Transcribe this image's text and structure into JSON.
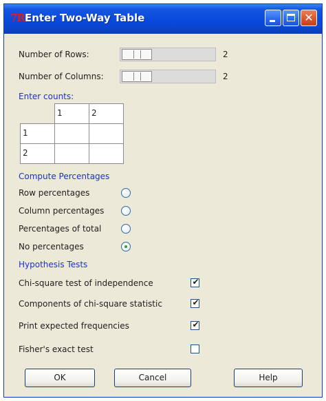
{
  "window": {
    "title": "Enter Two-Way Table",
    "app_icon": "7R"
  },
  "controls": {
    "rows": {
      "label": "Number of Rows:",
      "value": "2"
    },
    "columns": {
      "label": "Number of Columns:",
      "value": "2"
    }
  },
  "counts": {
    "heading": "Enter counts:",
    "col_headers": [
      "1",
      "2"
    ],
    "row_headers": [
      "1",
      "2"
    ],
    "cells": [
      [
        "",
        ""
      ],
      [
        "",
        ""
      ]
    ]
  },
  "percentages": {
    "heading": "Compute Percentages",
    "options": [
      {
        "label": "Row percentages",
        "selected": false
      },
      {
        "label": "Column percentages",
        "selected": false
      },
      {
        "label": "Percentages of total",
        "selected": false
      },
      {
        "label": "No percentages",
        "selected": true
      }
    ]
  },
  "tests": {
    "heading": "Hypothesis Tests",
    "options": [
      {
        "label": "Chi-square test of independence",
        "checked": true
      },
      {
        "label": "Components of chi-square statistic",
        "checked": true
      },
      {
        "label": "Print expected frequencies",
        "checked": true
      },
      {
        "label": "Fisher's exact test",
        "checked": false
      }
    ]
  },
  "buttons": {
    "ok": "OK",
    "cancel": "Cancel",
    "help": "Help"
  },
  "icons": {
    "app": "r-logo-icon",
    "minimize": "minimize-icon",
    "maximize": "maximize-icon",
    "close": "close-icon",
    "check": "✔"
  },
  "colors": {
    "title_bar": "#0a49dd",
    "section_heading": "#1a2fd8",
    "radio_selected": "#2f9e2f",
    "close_button": "#d7552c"
  }
}
